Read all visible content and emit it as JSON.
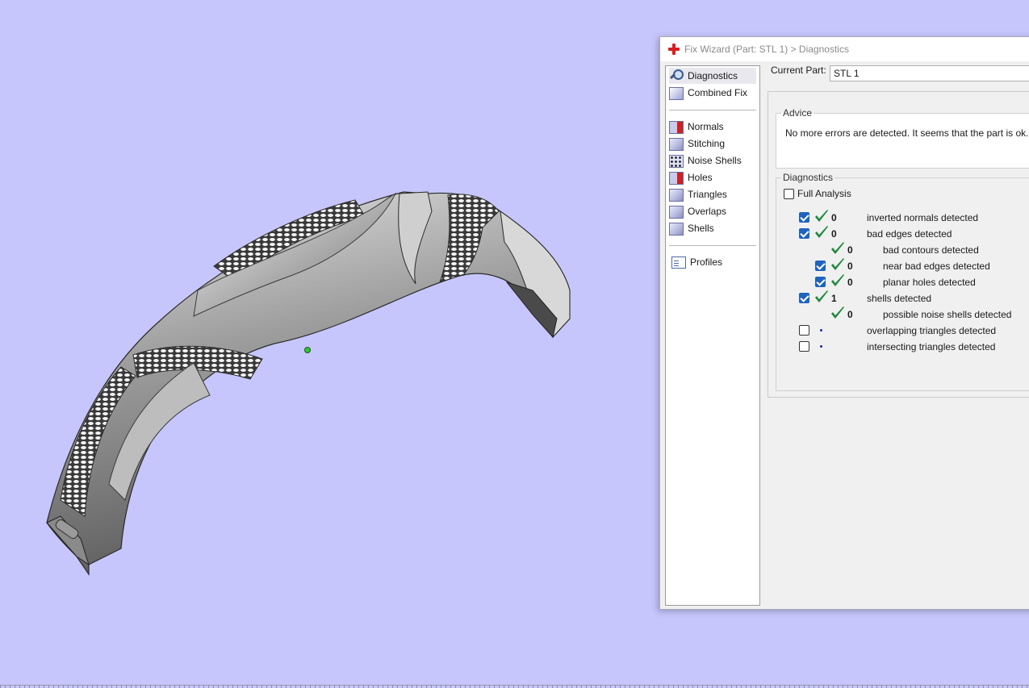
{
  "window": {
    "title": "Fix Wizard (Part: STL 1) > Diagnostics",
    "title_icon": "red-plus-icon"
  },
  "sidebar": {
    "items": [
      {
        "label": "Diagnostics",
        "icon": "magnifier-icon",
        "selected": true
      },
      {
        "label": "Combined Fix",
        "icon": "cube-icon"
      },
      {
        "label": "Normals",
        "icon": "normals-cube-icon"
      },
      {
        "label": "Stitching",
        "icon": "stitching-cube-icon"
      },
      {
        "label": "Noise Shells",
        "icon": "noise-shells-cube-icon"
      },
      {
        "label": "Holes",
        "icon": "holes-cube-icon"
      },
      {
        "label": "Triangles",
        "icon": "triangles-cube-icon"
      },
      {
        "label": "Overlaps",
        "icon": "overlaps-cube-icon"
      },
      {
        "label": "Shells",
        "icon": "shells-cube-icon"
      },
      {
        "label": "Profiles",
        "icon": "document-icon"
      }
    ]
  },
  "current_part": {
    "label": "Current Part:",
    "value": "STL 1"
  },
  "advice": {
    "title": "Advice",
    "text": "No more errors are detected. It seems that the part is ok. Note"
  },
  "diagnostics": {
    "title": "Diagnostics",
    "full_analysis": {
      "label": "Full Analysis",
      "checked": false
    },
    "rows": [
      {
        "checked": true,
        "status": "ok",
        "count": "0",
        "label": "inverted normals detected",
        "indent": 0,
        "has_checkbox": true
      },
      {
        "checked": true,
        "status": "ok",
        "count": "0",
        "label": "bad edges detected",
        "indent": 0,
        "has_checkbox": true
      },
      {
        "checked": false,
        "status": "ok",
        "count": "0",
        "label": "bad contours detected",
        "indent": 1,
        "has_checkbox": false
      },
      {
        "checked": true,
        "status": "ok",
        "count": "0",
        "label": "near bad edges detected",
        "indent": 1,
        "has_checkbox": true
      },
      {
        "checked": true,
        "status": "ok",
        "count": "0",
        "label": "planar holes detected",
        "indent": 1,
        "has_checkbox": true
      },
      {
        "checked": true,
        "status": "ok",
        "count": "1",
        "label": "shells detected",
        "indent": 0,
        "has_checkbox": true
      },
      {
        "checked": false,
        "status": "ok",
        "count": "0",
        "label": "possible noise shells detected",
        "indent": 1,
        "has_checkbox": false
      },
      {
        "checked": false,
        "status": "pending",
        "count": "",
        "label": "overlapping triangles detected",
        "indent": 0,
        "has_checkbox": true
      },
      {
        "checked": false,
        "status": "pending",
        "count": "",
        "label": "intersecting triangles detected",
        "indent": 0,
        "has_checkbox": true
      }
    ]
  },
  "colors": {
    "viewport_bg": "#c6c6fc",
    "check_green": "#1e8a3c",
    "checkbox_blue": "#1f63c0"
  }
}
